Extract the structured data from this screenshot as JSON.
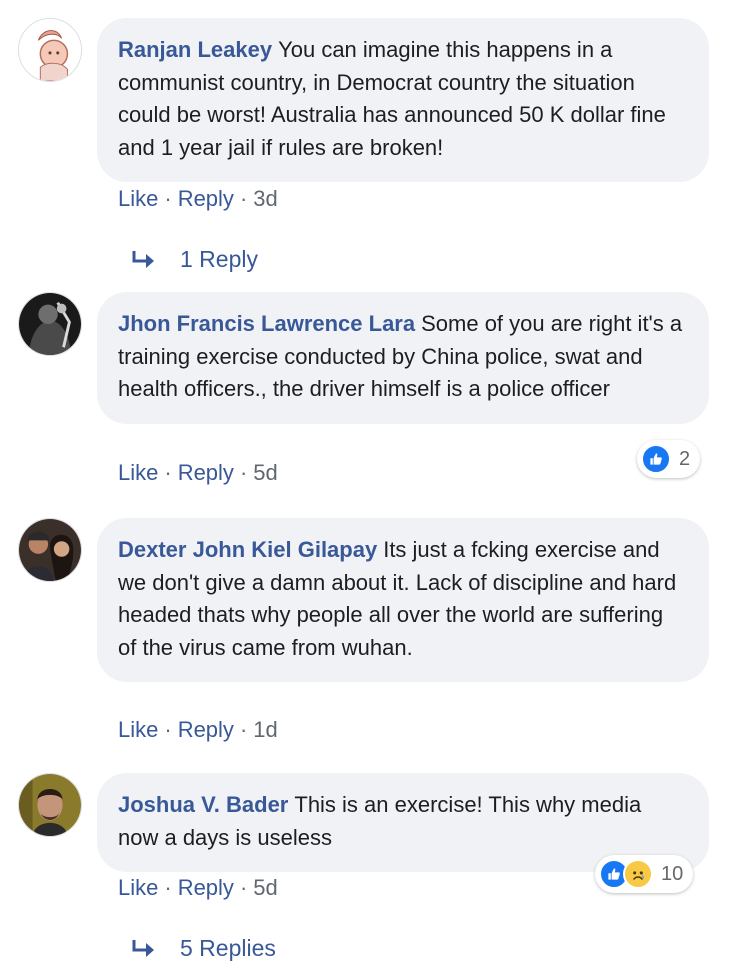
{
  "comments": [
    {
      "author": "Ranjan Leakey",
      "text": "You can imagine this happens in a communist country, in Democrat country the situation could be worst! Australia has announced 50 K dollar fine and 1 year jail if rules are broken!",
      "like_label": "Like",
      "reply_label": "Reply",
      "time": "3d",
      "replies_label": "1 Reply"
    },
    {
      "author": "Jhon Francis Lawrence Lara",
      "text": "Some of you are right it's a training exercise conducted by China police, swat and health officers., the driver himself is a police officer",
      "like_label": "Like",
      "reply_label": "Reply",
      "time": "5d",
      "reaction_count": "2",
      "reaction_icons": [
        "like-icon"
      ]
    },
    {
      "author": "Dexter John Kiel Gilapay",
      "text": "Its just a fcking exercise and we don't give a damn about it. Lack of discipline and hard headed thats why people all over the world are suffering of the virus came from wuhan.",
      "like_label": "Like",
      "reply_label": "Reply",
      "time": "1d"
    },
    {
      "author": "Joshua V. Bader",
      "text": "This is an exercise! This why media now a days is useless",
      "like_label": "Like",
      "reply_label": "Reply",
      "time": "5d",
      "reaction_count": "10",
      "reaction_icons": [
        "like-icon",
        "sad-icon"
      ],
      "replies_label": "5 Replies"
    }
  ],
  "colors": {
    "link": "#385898",
    "bubble": "#f0f2f5",
    "like_blue": "#1877f2",
    "meta": "#606770"
  }
}
